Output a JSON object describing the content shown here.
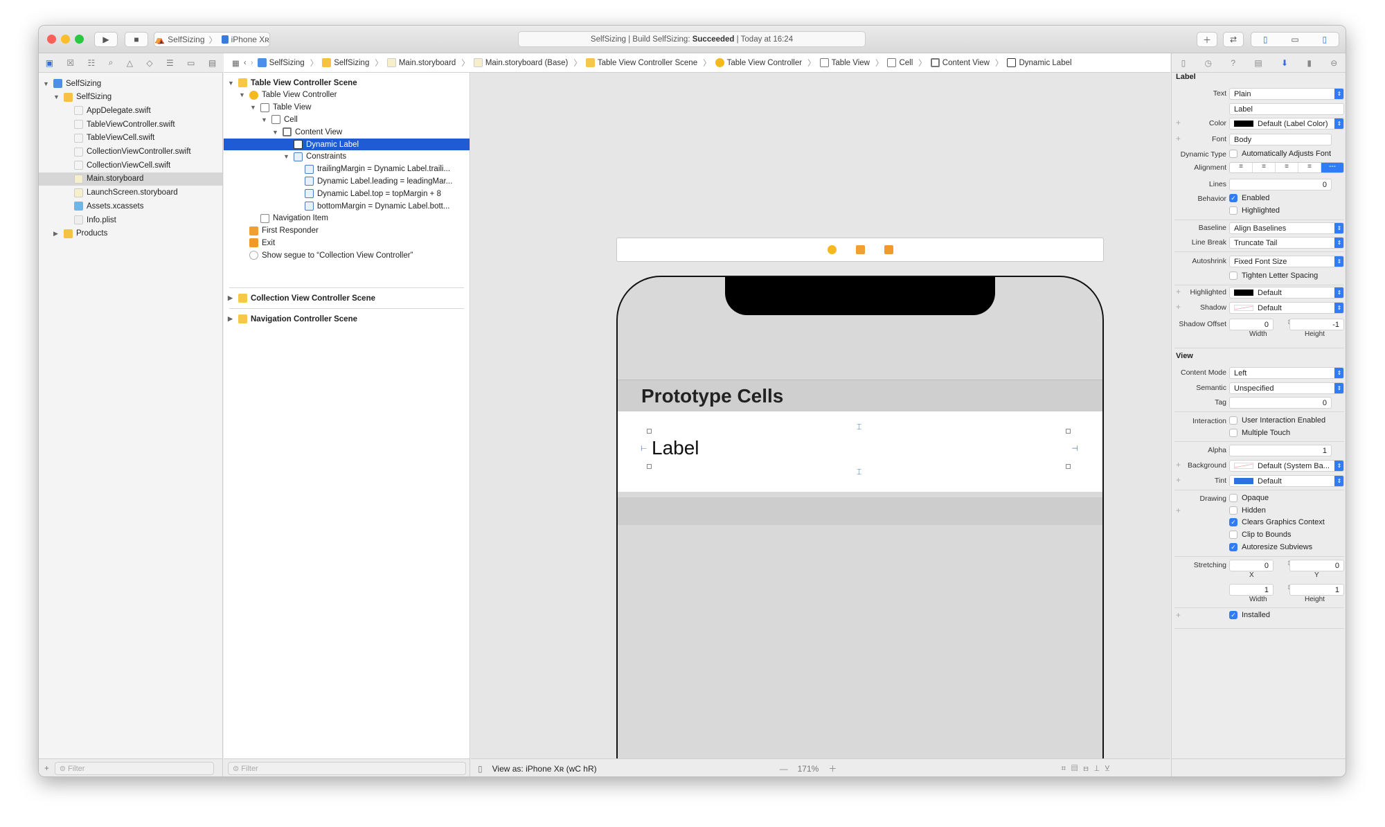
{
  "toolbar": {
    "scheme": "SelfSizing",
    "device": "iPhone Xʀ",
    "status_prefix": "SelfSizing | Build SelfSizing: ",
    "status_result": "Succeeded",
    "status_time": "| Today at 16:24"
  },
  "breadcrumbs": [
    "SelfSizing",
    "SelfSizing",
    "Main.storyboard",
    "Main.storyboard (Base)",
    "Table View Controller Scene",
    "Table View Controller",
    "Table View",
    "Cell",
    "Content View",
    "Dynamic Label"
  ],
  "navigator": {
    "items": [
      {
        "label": "SelfSizing",
        "depth": 0,
        "icon": "project-icon",
        "tri": "▼"
      },
      {
        "label": "SelfSizing",
        "depth": 1,
        "icon": "folder-icon",
        "tri": "▼"
      },
      {
        "label": "AppDelegate.swift",
        "depth": 2,
        "icon": "swift-file-icon"
      },
      {
        "label": "TableViewController.swift",
        "depth": 2,
        "icon": "swift-file-icon"
      },
      {
        "label": "TableViewCell.swift",
        "depth": 2,
        "icon": "swift-file-icon"
      },
      {
        "label": "CollectionViewController.swift",
        "depth": 2,
        "icon": "swift-file-icon"
      },
      {
        "label": "CollectionViewCell.swift",
        "depth": 2,
        "icon": "swift-file-icon"
      },
      {
        "label": "Main.storyboard",
        "depth": 2,
        "icon": "storyboard-icon",
        "selected": true
      },
      {
        "label": "LaunchScreen.storyboard",
        "depth": 2,
        "icon": "storyboard-icon"
      },
      {
        "label": "Assets.xcassets",
        "depth": 2,
        "icon": "assets-icon"
      },
      {
        "label": "Info.plist",
        "depth": 2,
        "icon": "plist-icon"
      },
      {
        "label": "Products",
        "depth": 1,
        "icon": "folder-icon",
        "tri": "▶"
      }
    ],
    "filter_placeholder": "Filter"
  },
  "outline": {
    "items": [
      {
        "label": "Table View Controller Scene",
        "depth": 0,
        "bold": true,
        "tri": "▼",
        "icon": "scene-icon"
      },
      {
        "label": "Table View Controller",
        "depth": 1,
        "tri": "▼",
        "icon": "view-controller-icon"
      },
      {
        "label": "Table View",
        "depth": 2,
        "tri": "▼",
        "icon": "table-view-icon"
      },
      {
        "label": "Cell",
        "depth": 3,
        "tri": "▼",
        "icon": "cell-icon"
      },
      {
        "label": "Content View",
        "depth": 4,
        "tri": "▼",
        "icon": "content-view-icon"
      },
      {
        "label": "Dynamic Label",
        "depth": 5,
        "icon": "label-icon",
        "selected": true
      },
      {
        "label": "Constraints",
        "depth": 5,
        "tri": "▼",
        "icon": "constraints-icon"
      },
      {
        "label": "trailingMargin = Dynamic Label.traili...",
        "depth": 6,
        "icon": "constraint-icon"
      },
      {
        "label": "Dynamic Label.leading = leadingMar...",
        "depth": 6,
        "icon": "constraint-icon"
      },
      {
        "label": "Dynamic Label.top = topMargin + 8",
        "depth": 6,
        "icon": "constraint-icon"
      },
      {
        "label": "bottomMargin = Dynamic Label.bott...",
        "depth": 6,
        "icon": "constraint-icon"
      },
      {
        "label": "Navigation Item",
        "depth": 2,
        "icon": "navigation-item-icon"
      },
      {
        "label": "First Responder",
        "depth": 1,
        "icon": "first-responder-icon"
      },
      {
        "label": "Exit",
        "depth": 1,
        "icon": "exit-icon"
      },
      {
        "label": "Show segue to “Collection View Controller”",
        "depth": 1,
        "icon": "segue-icon"
      }
    ],
    "scenes": [
      {
        "label": "Collection View Controller Scene"
      },
      {
        "label": "Navigation Controller Scene"
      }
    ],
    "filter_placeholder": "Filter"
  },
  "canvas": {
    "header": "Prototype Cells",
    "cell_label": "Label",
    "view_as": "View as: iPhone Xʀ (wC hR)",
    "zoom": "171%"
  },
  "inspector": {
    "label_section": "Label",
    "text_label": "Text",
    "text_value": "Plain",
    "label_text": "Label",
    "color_label": "Color",
    "color_value": "Default (Label Color)",
    "font_label": "Font",
    "font_value": "Body",
    "dynamic_type_label": "Dynamic Type",
    "dynamic_type_value": "Automatically Adjusts Font",
    "alignment_label": "Alignment",
    "lines_label": "Lines",
    "lines_value": "0",
    "behavior_label": "Behavior",
    "enabled": "Enabled",
    "highlighted_chk": "Highlighted",
    "baseline_label": "Baseline",
    "baseline_value": "Align Baselines",
    "linebreak_label": "Line Break",
    "linebreak_value": "Truncate Tail",
    "autoshrink_label": "Autoshrink",
    "autoshrink_value": "Fixed Font Size",
    "tighten": "Tighten Letter Spacing",
    "highlighted_label": "Highlighted",
    "highlighted_value": "Default",
    "shadow_label": "Shadow",
    "shadow_value": "Default",
    "shadow_offset_label": "Shadow Offset",
    "shadow_w": "0",
    "shadow_h": "-1",
    "width": "Width",
    "height": "Height",
    "view_section": "View",
    "content_mode_label": "Content Mode",
    "content_mode_value": "Left",
    "semantic_label": "Semantic",
    "semantic_value": "Unspecified",
    "tag_label": "Tag",
    "tag_value": "0",
    "interaction_label": "Interaction",
    "user_interaction": "User Interaction Enabled",
    "multiple_touch": "Multiple Touch",
    "alpha_label": "Alpha",
    "alpha_value": "1",
    "background_label": "Background",
    "background_value": "Default (System Ba...",
    "tint_label": "Tint",
    "tint_value": "Default",
    "drawing_label": "Drawing",
    "opaque": "Opaque",
    "hidden": "Hidden",
    "clears": "Clears Graphics Context",
    "clip": "Clip to Bounds",
    "autoresize": "Autoresize Subviews",
    "stretching_label": "Stretching",
    "stretch_x": "0",
    "stretch_y": "0",
    "x": "X",
    "y": "Y",
    "stretch_w": "1",
    "stretch_h": "1",
    "installed": "Installed"
  },
  "colors": {
    "accent": "#1f5bd4",
    "tint": "#2f6fe0",
    "label_color": "#000000"
  }
}
